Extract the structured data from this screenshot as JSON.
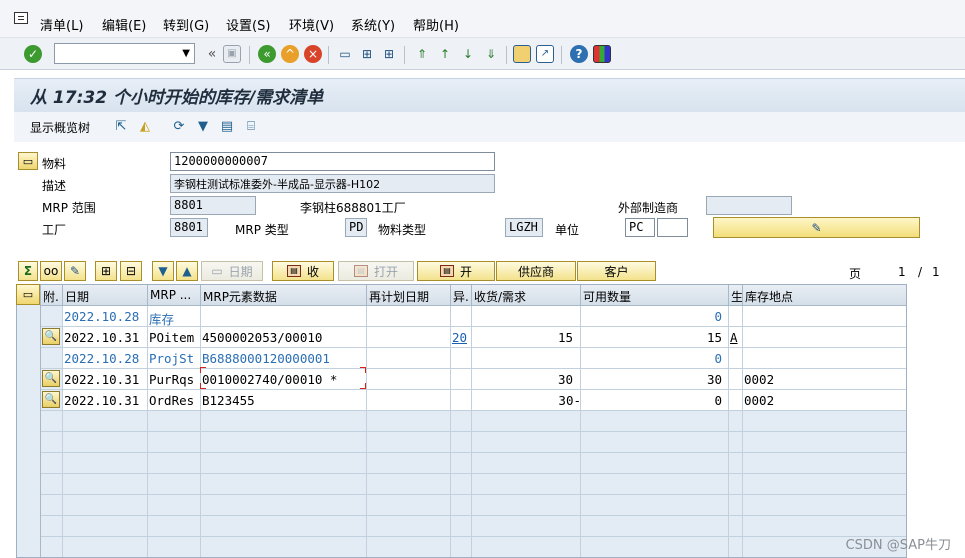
{
  "menubar": {
    "items": [
      "清单(L)",
      "编辑(E)",
      "转到(G)",
      "设置(S)",
      "环境(V)",
      "系统(Y)",
      "帮助(H)"
    ]
  },
  "toolbar": {
    "command_field": "",
    "icons": [
      "enter-icon",
      "save-icon",
      "back-icon",
      "exit-icon",
      "cancel-icon",
      "print-icon",
      "find-icon",
      "find-next-icon",
      "first-page-icon",
      "previous-page-icon",
      "next-page-icon",
      "last-page-icon",
      "new-session-icon",
      "shortcut-icon",
      "help-icon",
      "customize-layout-icon"
    ]
  },
  "title": "从 17:32 个小时开始的库存/需求清单",
  "app_toolbar": {
    "overview_label": "显示概览树"
  },
  "header": {
    "material_label": "物料",
    "material_value": "1200000000007",
    "description_label": "描述",
    "description_value": "李钢柱测试标准委外-半成品-显示器-H102",
    "mrp_area_label": "MRP 范围",
    "mrp_area_value": "8801",
    "mrp_area_desc": "李钢柱688801工厂",
    "external_label": "外部制造商",
    "external_value": "",
    "plant_label": "工厂",
    "plant_value": "8801",
    "mrp_type_label": "MRP 类型",
    "mrp_type_value": "PD",
    "material_type_label": "物料类型",
    "material_type_value": "LGZH",
    "unit_label": "单位",
    "unit_value": "PC",
    "unit_extra": ""
  },
  "grid_toolbar": {
    "date_label": "日期",
    "receive_label": "收",
    "open_label": "打开",
    "open2_label": "开",
    "vendor_label": "供应商",
    "customer_label": "客户",
    "page_label": "页",
    "page_current": "1",
    "page_sep": "/",
    "page_total": "1"
  },
  "table": {
    "headers": [
      "附.",
      "日期",
      "MRP ...",
      "MRP元素数据",
      "再计划日期",
      "异.",
      "收货/需求",
      "可用数量",
      "生",
      "库存地点"
    ],
    "rows": [
      {
        "date": "2022.10.28",
        "element": "库存",
        "data": "",
        "replan": "",
        "exception": "",
        "receipt": "",
        "available": "0",
        "flag": "",
        "sloc": "",
        "blue": true
      },
      {
        "date": "2022.10.31",
        "element": "POitem",
        "data": "4500002053/00010",
        "replan": "",
        "exception": "20",
        "receipt": "15",
        "available": "15",
        "flag": "A",
        "sloc": "",
        "blue": false
      },
      {
        "date": "2022.10.28",
        "element": "ProjSt",
        "data": "B6888000120000001",
        "replan": "",
        "exception": "",
        "receipt": "",
        "available": "0",
        "flag": "",
        "sloc": "",
        "blue": true
      },
      {
        "date": "2022.10.31",
        "element": "PurRqs",
        "data": "0010002740/00010 *",
        "replan": "",
        "exception": "",
        "receipt": "30",
        "available": "30",
        "flag": "",
        "sloc": "0002",
        "blue": false
      },
      {
        "date": "2022.10.31",
        "element": "OrdRes",
        "data": "B123455",
        "replan": "",
        "exception": "",
        "receipt": "30-",
        "available": "0",
        "flag": "",
        "sloc": "0002",
        "blue": false
      }
    ]
  },
  "watermark": "CSDN @SAP牛刀"
}
